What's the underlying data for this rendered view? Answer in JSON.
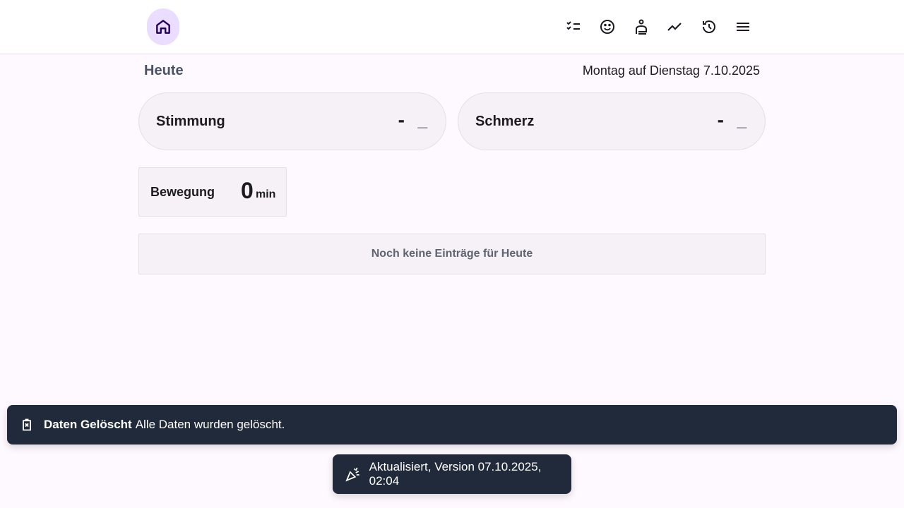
{
  "header": {
    "nav": [
      {
        "icon": "home-icon",
        "active": true
      },
      {
        "icon": "checklist-icon"
      },
      {
        "icon": "smiley-icon"
      },
      {
        "icon": "injury-icon"
      },
      {
        "icon": "trend-icon"
      },
      {
        "icon": "history-icon"
      },
      {
        "icon": "menu-icon"
      }
    ]
  },
  "main": {
    "title": "Heute",
    "date": "Montag auf Dienstag 7.10.2025",
    "mood": {
      "label": "Stimmung",
      "value": "-",
      "secondary": "_"
    },
    "pain": {
      "label": "Schmerz",
      "value": "-",
      "secondary": "_"
    },
    "exercise": {
      "label": "Bewegung",
      "value": "0",
      "unit": "min"
    },
    "empty_text": "Noch keine Einträge für Heute"
  },
  "toasts": {
    "deleted": {
      "title": "Daten Gelöscht",
      "message": "Alle Daten wurden gelöscht."
    },
    "updated": {
      "message": "Aktualisiert, Version 07.10.2025, 02:04"
    }
  }
}
